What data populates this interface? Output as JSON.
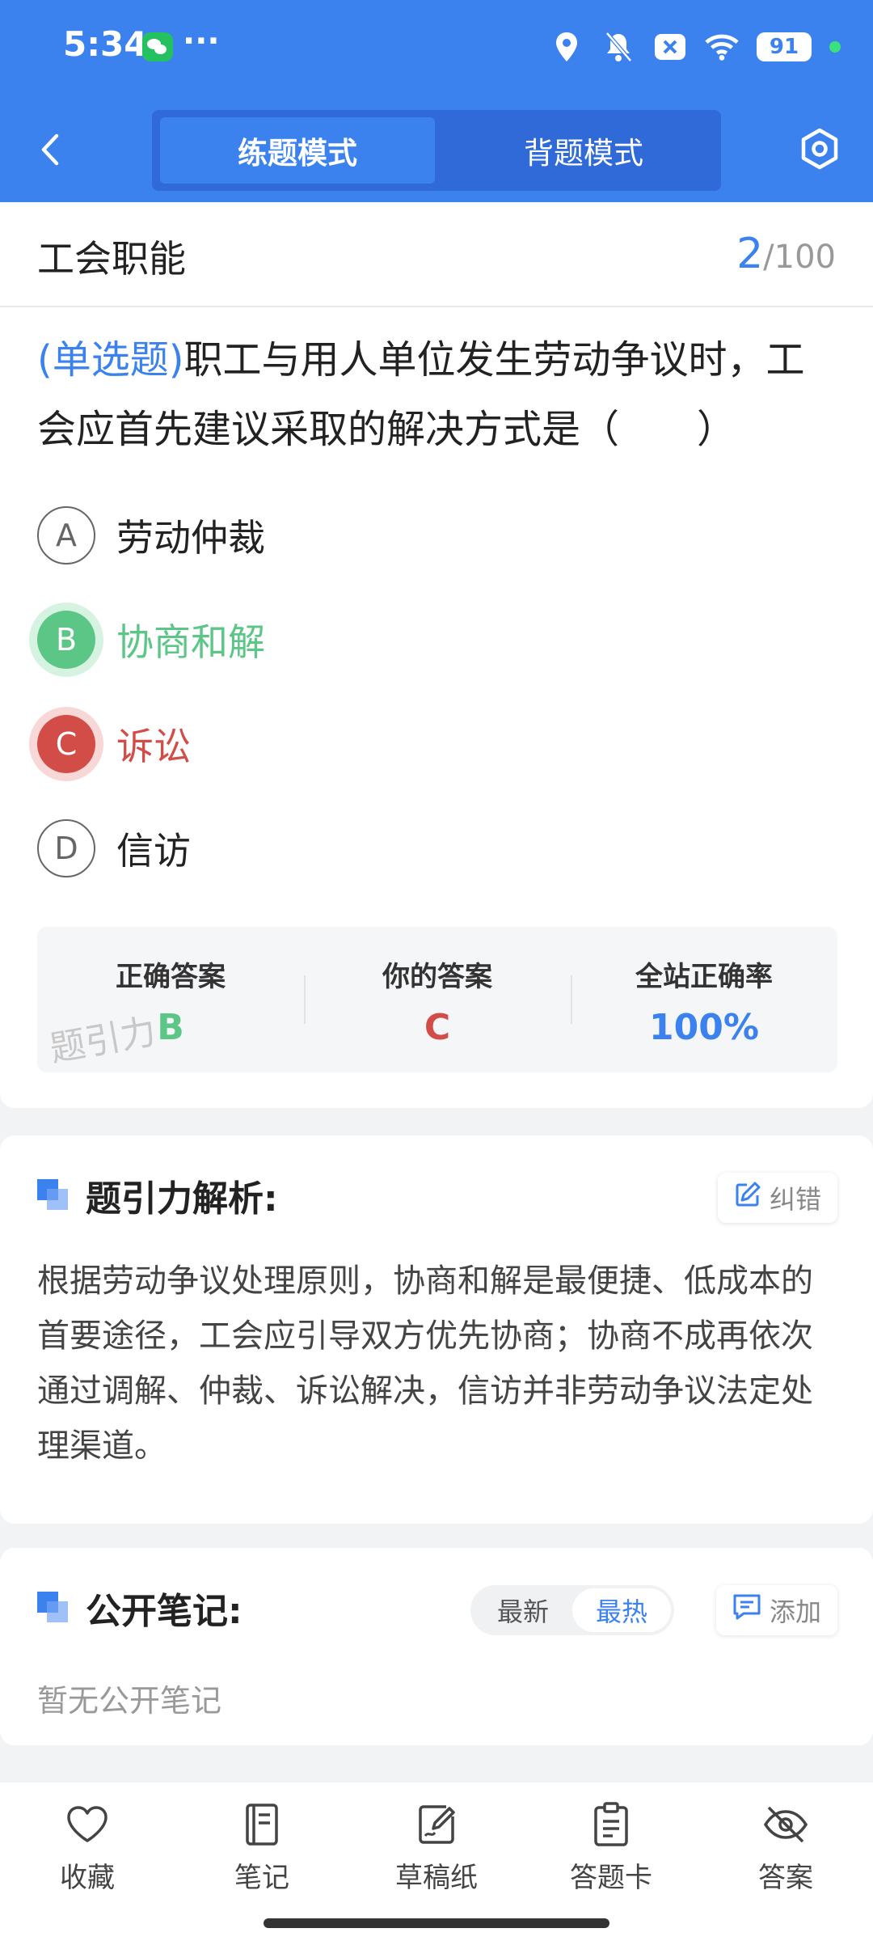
{
  "status_bar": {
    "time": "5:34",
    "more": "···",
    "battery": "91"
  },
  "nav": {
    "mode_practice": "练题模式",
    "mode_memorize": "背题模式"
  },
  "question": {
    "category": "工会职能",
    "current": "2",
    "separator": "/",
    "total": "100",
    "type": "(单选题)",
    "text": "职工与用人单位发生劳动争议时，工会应首先建议采取的解决方式是（　　）",
    "options": [
      {
        "letter": "A",
        "text": "劳动仲裁",
        "state": "normal"
      },
      {
        "letter": "B",
        "text": "协商和解",
        "state": "correct"
      },
      {
        "letter": "C",
        "text": "诉讼",
        "state": "wrong"
      },
      {
        "letter": "D",
        "text": "信访",
        "state": "normal"
      }
    ]
  },
  "stats": {
    "correct_label": "正确答案",
    "correct_value": "B",
    "yours_label": "你的答案",
    "yours_value": "C",
    "rate_label": "全站正确率",
    "rate_value": "100%",
    "watermark": "题引力"
  },
  "analysis": {
    "title": "题引力解析:",
    "report_label": "纠错",
    "text": "根据劳动争议处理原则，协商和解是最便捷、低成本的首要途径，工会应引导双方优先协商；协商不成再依次通过调解、仲裁、诉讼解决，信访并非劳动争议法定处理渠道。"
  },
  "notes": {
    "title": "公开笔记:",
    "sort_latest": "最新",
    "sort_hot": "最热",
    "add_label": "添加",
    "empty": "暂无公开笔记"
  },
  "bottom_bar": {
    "favorite": "收藏",
    "notes": "笔记",
    "scratch": "草稿纸",
    "answer_card": "答题卡",
    "answer": "答案"
  },
  "colors": {
    "primary": "#3b82ef",
    "correct": "#5cc686",
    "wrong": "#d24c48"
  }
}
